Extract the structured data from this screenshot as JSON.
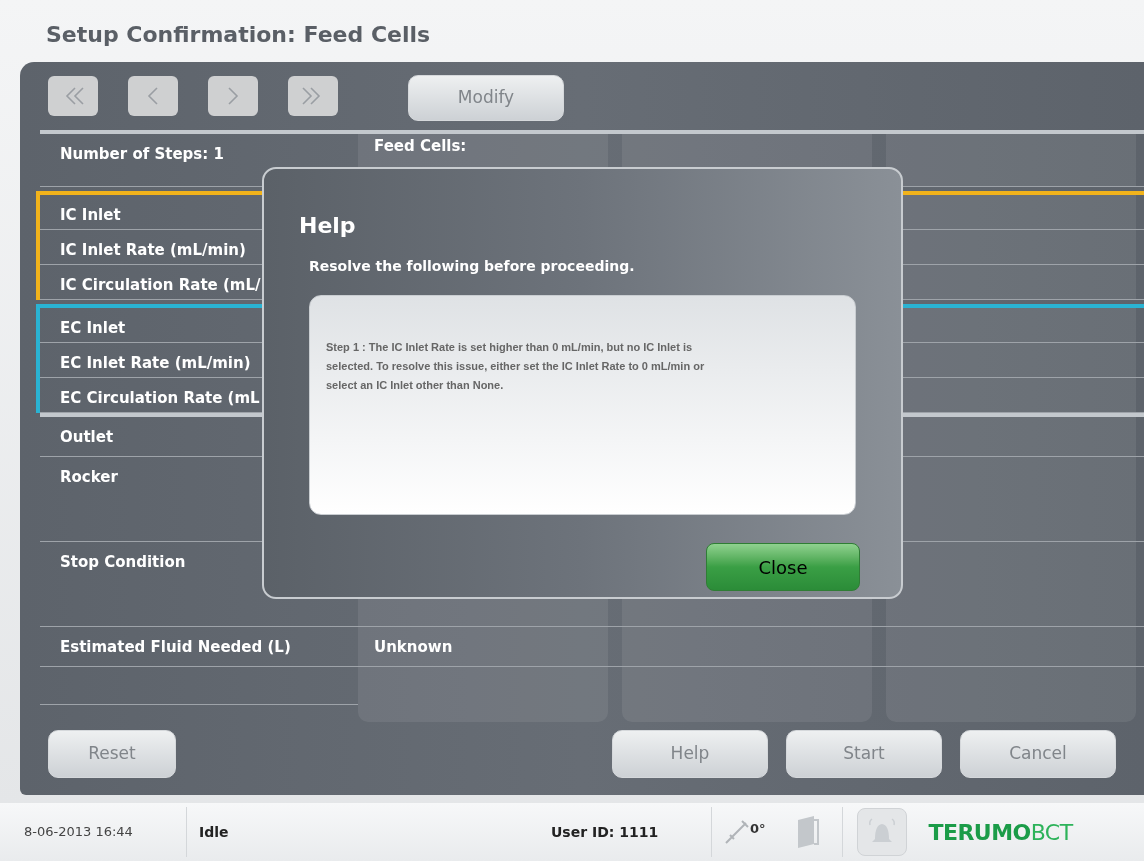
{
  "title": "Setup Confirmation: Feed Cells",
  "toolbar": {
    "nav_buttons": [
      {
        "kind": "first",
        "disabled": true
      },
      {
        "kind": "previous",
        "disabled": true
      },
      {
        "kind": "next",
        "disabled": true
      },
      {
        "kind": "last",
        "disabled": true
      }
    ],
    "modify_button": {
      "label": "Modify",
      "disabled": true
    }
  },
  "sections": [
    {
      "kind": "ruled",
      "rows": [
        {
          "kind": "short",
          "label": "Number of Steps: 1",
          "values": [
            "Feed Cells:"
          ]
        }
      ]
    },
    {
      "kind": "group",
      "color": "#f2b31b",
      "rows": [
        {
          "kind": "single",
          "label": "IC Inlet",
          "values": []
        },
        {
          "kind": "single",
          "label": "IC Inlet Rate (mL/min)",
          "values": []
        },
        {
          "kind": "single",
          "label": "IC Circulation Rate (mL/",
          "values": []
        }
      ]
    },
    {
      "kind": "group",
      "color": "#2ab3d3",
      "rows": [
        {
          "kind": "single",
          "label": "EC Inlet",
          "values": []
        },
        {
          "kind": "single",
          "label": "EC Inlet Rate (mL/min)",
          "values": []
        },
        {
          "kind": "single",
          "label": "EC Circulation Rate (mL",
          "values": []
        }
      ]
    },
    {
      "kind": "ruled",
      "rows": [
        {
          "kind": "medium",
          "label": "Outlet",
          "values": []
        },
        {
          "kind": "tall",
          "label": "Rocker",
          "values": []
        },
        {
          "kind": "tall",
          "label": "Stop Condition",
          "values": []
        },
        {
          "kind": "medium",
          "label": "Estimated Fluid Needed (L)",
          "values": [
            "Unknown"
          ]
        }
      ]
    }
  ],
  "footer": {
    "left_buttons": [
      {
        "label": "Reset",
        "disabled": true
      }
    ],
    "right_buttons": [
      {
        "label": "Help",
        "disabled": true
      },
      {
        "label": "Start",
        "disabled": true
      },
      {
        "label": "Cancel",
        "disabled": true
      }
    ]
  },
  "dialog": {
    "title": "Help",
    "instruction": "Resolve the following before proceeding.",
    "message": "Step 1 : The IC Inlet Rate is set higher than 0 mL/min, but no IC Inlet is selected. To resolve this issue, either set the IC Inlet Rate to 0 mL/min or select an IC Inlet other than None.",
    "close_button": "Close"
  },
  "status_bar": {
    "date_time": "8-06-2013 16:44",
    "state": "Idle",
    "user_id": "User ID: 1111",
    "rocker_angle": "0°",
    "logo": [
      "TERUMO",
      "BCT"
    ]
  }
}
